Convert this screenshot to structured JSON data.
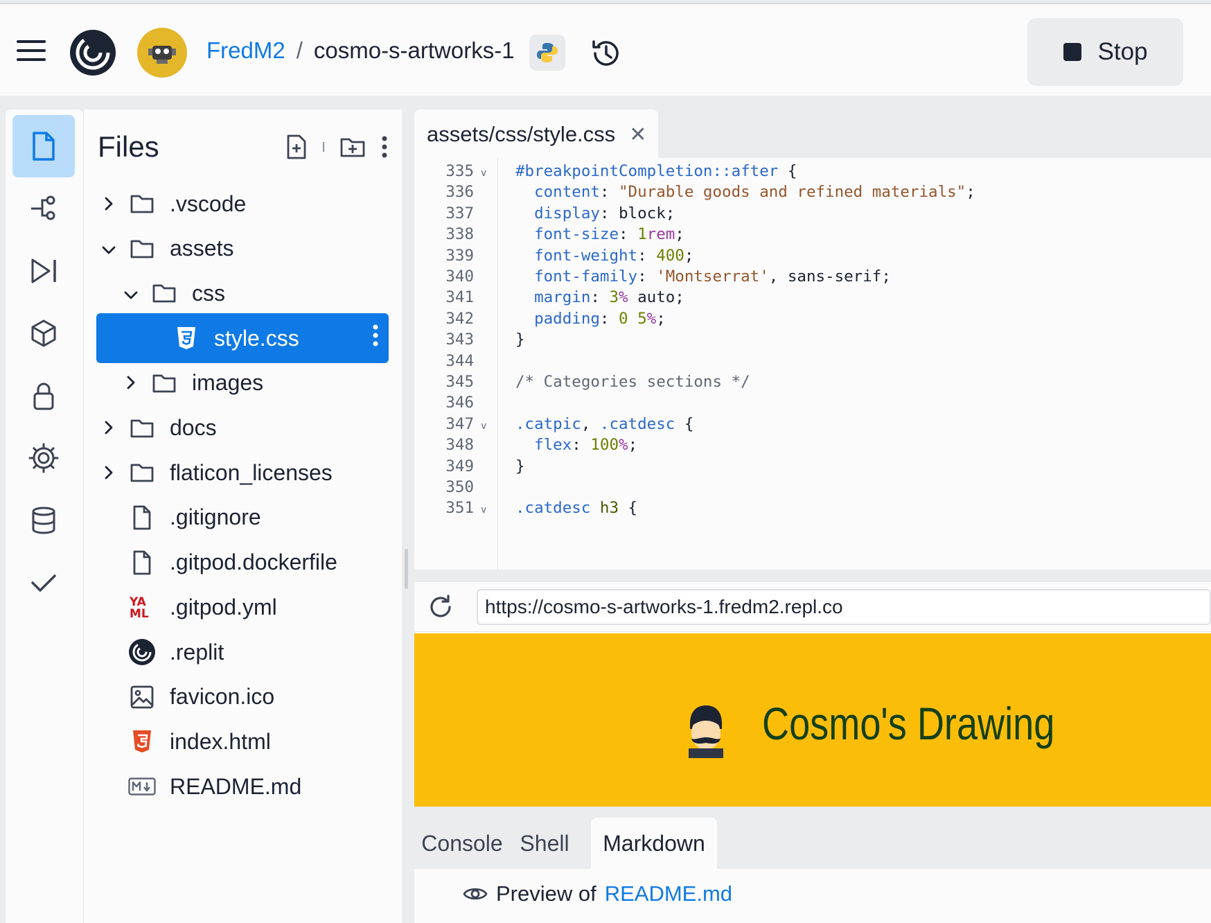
{
  "header": {
    "user": "FredM2",
    "separator": "/",
    "repl_name": "cosmo-s-artworks-1",
    "stop_label": "Stop"
  },
  "files_panel": {
    "title": "Files",
    "items": [
      {
        "label": ".vscode",
        "type": "folder",
        "expanded": false
      },
      {
        "label": "assets",
        "type": "folder",
        "expanded": true
      },
      {
        "label": "css",
        "type": "folder",
        "expanded": true
      },
      {
        "label": "style.css",
        "type": "css",
        "selected": true
      },
      {
        "label": "images",
        "type": "folder",
        "expanded": false
      },
      {
        "label": "docs",
        "type": "folder",
        "expanded": false
      },
      {
        "label": "flaticon_licenses",
        "type": "folder",
        "expanded": false
      },
      {
        "label": ".gitignore",
        "type": "file"
      },
      {
        "label": ".gitpod.dockerfile",
        "type": "file"
      },
      {
        "label": ".gitpod.yml",
        "type": "yaml"
      },
      {
        "label": ".replit",
        "type": "replit"
      },
      {
        "label": "favicon.ico",
        "type": "image"
      },
      {
        "label": "index.html",
        "type": "html"
      },
      {
        "label": "README.md",
        "type": "markdown"
      }
    ]
  },
  "editor": {
    "tab_label": "assets/css/style.css",
    "line_numbers": [
      "335",
      "336",
      "337",
      "338",
      "339",
      "340",
      "341",
      "342",
      "343",
      "344",
      "345",
      "346",
      "347",
      "348",
      "349",
      "350",
      "351"
    ],
    "lines": [
      "#breakpointCompletion::after {",
      "  content: \"Durable goods and refined materials\";",
      "  display: block;",
      "  font-size: 1rem;",
      "  font-weight: 400;",
      "  font-family: 'Montserrat', sans-serif;",
      "  margin: 3% auto;",
      "  padding: 0 5%;",
      "}",
      "",
      "/* Categories sections */",
      "",
      ".catpic, .catdesc {",
      "  flex: 100%;",
      "}",
      "",
      ".catdesc h3 {"
    ]
  },
  "preview": {
    "url": "https://cosmo-s-artworks-1.fredm2.repl.co",
    "site_title": "Cosmo's Drawing",
    "site_bg_color": "#fbbd08"
  },
  "bottom_panel": {
    "tabs": [
      "Console",
      "Shell",
      "Markdown"
    ],
    "active_tab": "Markdown",
    "preview_prefix": "Preview of",
    "preview_file": "README.md"
  },
  "colors": {
    "accent": "#0f7ae5",
    "selection": "#0f7ae5"
  }
}
